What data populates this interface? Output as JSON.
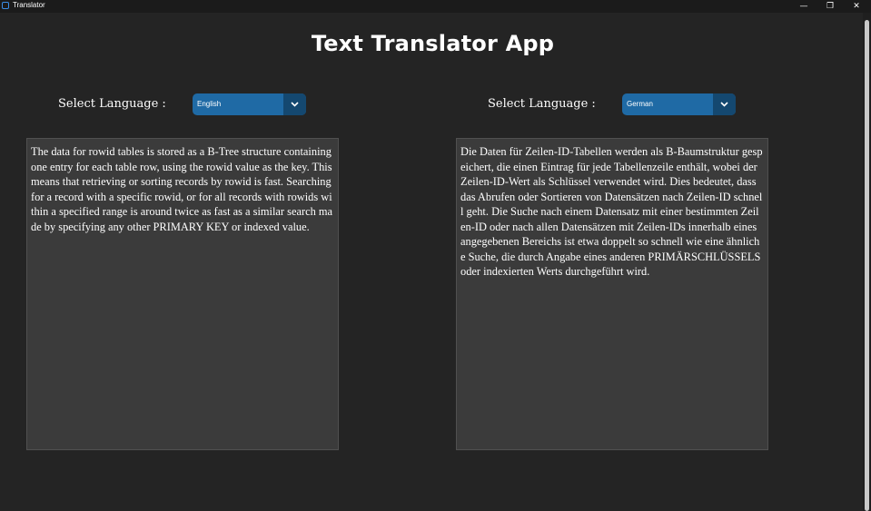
{
  "window": {
    "title": "Translator",
    "controls": {
      "minimize": "—",
      "maximize": "❐",
      "close": "✕"
    }
  },
  "app": {
    "title": "Text Translator App"
  },
  "source": {
    "label": "Select Language :",
    "language": "English",
    "text": "The data for rowid tables is stored as a B-Tree structure containing one entry for each table row, using the rowid value as the key. This means that retrieving or sorting records by rowid is fast. Searching for a record with a specific rowid, or for all records with rowids within a specified range is around twice as fast as a similar search made by specifying any other PRIMARY KEY or indexed value."
  },
  "target": {
    "label": "Select Language :",
    "language": "German",
    "text": "Die Daten für Zeilen-ID-Tabellen werden als B-Baumstruktur gespeichert, die einen Eintrag für jede Tabellenzeile enthält, wobei der Zeilen-ID-Wert als Schlüssel verwendet wird. Dies bedeutet, dass das Abrufen oder Sortieren von Datensätzen nach Zeilen-ID schnell geht. Die Suche nach einem Datensatz mit einer bestimmten Zeilen-ID oder nach allen Datensätzen mit Zeilen-IDs innerhalb eines angegebenen Bereichs ist etwa doppelt so schnell wie eine ähnliche Suche, die durch Angabe eines anderen PRIMÄRSCHLÜSSELS oder indexierten Werts durchgeführt wird."
  },
  "colors": {
    "background": "#242424",
    "accent": "#1f6aa5",
    "accent_dark": "#144870",
    "textbox": "#3b3b3b"
  }
}
